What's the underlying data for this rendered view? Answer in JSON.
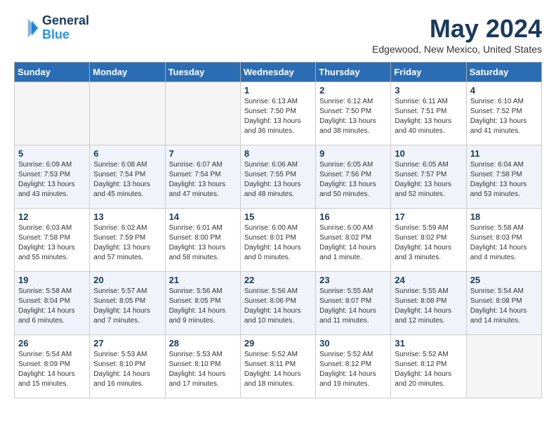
{
  "header": {
    "logo_line1": "General",
    "logo_line2": "Blue",
    "month_year": "May 2024",
    "location": "Edgewood, New Mexico, United States"
  },
  "days_of_week": [
    "Sunday",
    "Monday",
    "Tuesday",
    "Wednesday",
    "Thursday",
    "Friday",
    "Saturday"
  ],
  "weeks": [
    [
      {
        "day": "",
        "info": ""
      },
      {
        "day": "",
        "info": ""
      },
      {
        "day": "",
        "info": ""
      },
      {
        "day": "1",
        "info": "Sunrise: 6:13 AM\nSunset: 7:50 PM\nDaylight: 13 hours\nand 36 minutes."
      },
      {
        "day": "2",
        "info": "Sunrise: 6:12 AM\nSunset: 7:50 PM\nDaylight: 13 hours\nand 38 minutes."
      },
      {
        "day": "3",
        "info": "Sunrise: 6:11 AM\nSunset: 7:51 PM\nDaylight: 13 hours\nand 40 minutes."
      },
      {
        "day": "4",
        "info": "Sunrise: 6:10 AM\nSunset: 7:52 PM\nDaylight: 13 hours\nand 41 minutes."
      }
    ],
    [
      {
        "day": "5",
        "info": "Sunrise: 6:09 AM\nSunset: 7:53 PM\nDaylight: 13 hours\nand 43 minutes."
      },
      {
        "day": "6",
        "info": "Sunrise: 6:08 AM\nSunset: 7:54 PM\nDaylight: 13 hours\nand 45 minutes."
      },
      {
        "day": "7",
        "info": "Sunrise: 6:07 AM\nSunset: 7:54 PM\nDaylight: 13 hours\nand 47 minutes."
      },
      {
        "day": "8",
        "info": "Sunrise: 6:06 AM\nSunset: 7:55 PM\nDaylight: 13 hours\nand 48 minutes."
      },
      {
        "day": "9",
        "info": "Sunrise: 6:05 AM\nSunset: 7:56 PM\nDaylight: 13 hours\nand 50 minutes."
      },
      {
        "day": "10",
        "info": "Sunrise: 6:05 AM\nSunset: 7:57 PM\nDaylight: 13 hours\nand 52 minutes."
      },
      {
        "day": "11",
        "info": "Sunrise: 6:04 AM\nSunset: 7:58 PM\nDaylight: 13 hours\nand 53 minutes."
      }
    ],
    [
      {
        "day": "12",
        "info": "Sunrise: 6:03 AM\nSunset: 7:58 PM\nDaylight: 13 hours\nand 55 minutes."
      },
      {
        "day": "13",
        "info": "Sunrise: 6:02 AM\nSunset: 7:59 PM\nDaylight: 13 hours\nand 57 minutes."
      },
      {
        "day": "14",
        "info": "Sunrise: 6:01 AM\nSunset: 8:00 PM\nDaylight: 13 hours\nand 58 minutes."
      },
      {
        "day": "15",
        "info": "Sunrise: 6:00 AM\nSunset: 8:01 PM\nDaylight: 14 hours\nand 0 minutes."
      },
      {
        "day": "16",
        "info": "Sunrise: 6:00 AM\nSunset: 8:02 PM\nDaylight: 14 hours\nand 1 minute."
      },
      {
        "day": "17",
        "info": "Sunrise: 5:59 AM\nSunset: 8:02 PM\nDaylight: 14 hours\nand 3 minutes."
      },
      {
        "day": "18",
        "info": "Sunrise: 5:58 AM\nSunset: 8:03 PM\nDaylight: 14 hours\nand 4 minutes."
      }
    ],
    [
      {
        "day": "19",
        "info": "Sunrise: 5:58 AM\nSunset: 8:04 PM\nDaylight: 14 hours\nand 6 minutes."
      },
      {
        "day": "20",
        "info": "Sunrise: 5:57 AM\nSunset: 8:05 PM\nDaylight: 14 hours\nand 7 minutes."
      },
      {
        "day": "21",
        "info": "Sunrise: 5:56 AM\nSunset: 8:05 PM\nDaylight: 14 hours\nand 9 minutes."
      },
      {
        "day": "22",
        "info": "Sunrise: 5:56 AM\nSunset: 8:06 PM\nDaylight: 14 hours\nand 10 minutes."
      },
      {
        "day": "23",
        "info": "Sunrise: 5:55 AM\nSunset: 8:07 PM\nDaylight: 14 hours\nand 11 minutes."
      },
      {
        "day": "24",
        "info": "Sunrise: 5:55 AM\nSunset: 8:08 PM\nDaylight: 14 hours\nand 12 minutes."
      },
      {
        "day": "25",
        "info": "Sunrise: 5:54 AM\nSunset: 8:08 PM\nDaylight: 14 hours\nand 14 minutes."
      }
    ],
    [
      {
        "day": "26",
        "info": "Sunrise: 5:54 AM\nSunset: 8:09 PM\nDaylight: 14 hours\nand 15 minutes."
      },
      {
        "day": "27",
        "info": "Sunrise: 5:53 AM\nSunset: 8:10 PM\nDaylight: 14 hours\nand 16 minutes."
      },
      {
        "day": "28",
        "info": "Sunrise: 5:53 AM\nSunset: 8:10 PM\nDaylight: 14 hours\nand 17 minutes."
      },
      {
        "day": "29",
        "info": "Sunrise: 5:52 AM\nSunset: 8:11 PM\nDaylight: 14 hours\nand 18 minutes."
      },
      {
        "day": "30",
        "info": "Sunrise: 5:52 AM\nSunset: 8:12 PM\nDaylight: 14 hours\nand 19 minutes."
      },
      {
        "day": "31",
        "info": "Sunrise: 5:52 AM\nSunset: 8:12 PM\nDaylight: 14 hours\nand 20 minutes."
      },
      {
        "day": "",
        "info": ""
      }
    ]
  ]
}
